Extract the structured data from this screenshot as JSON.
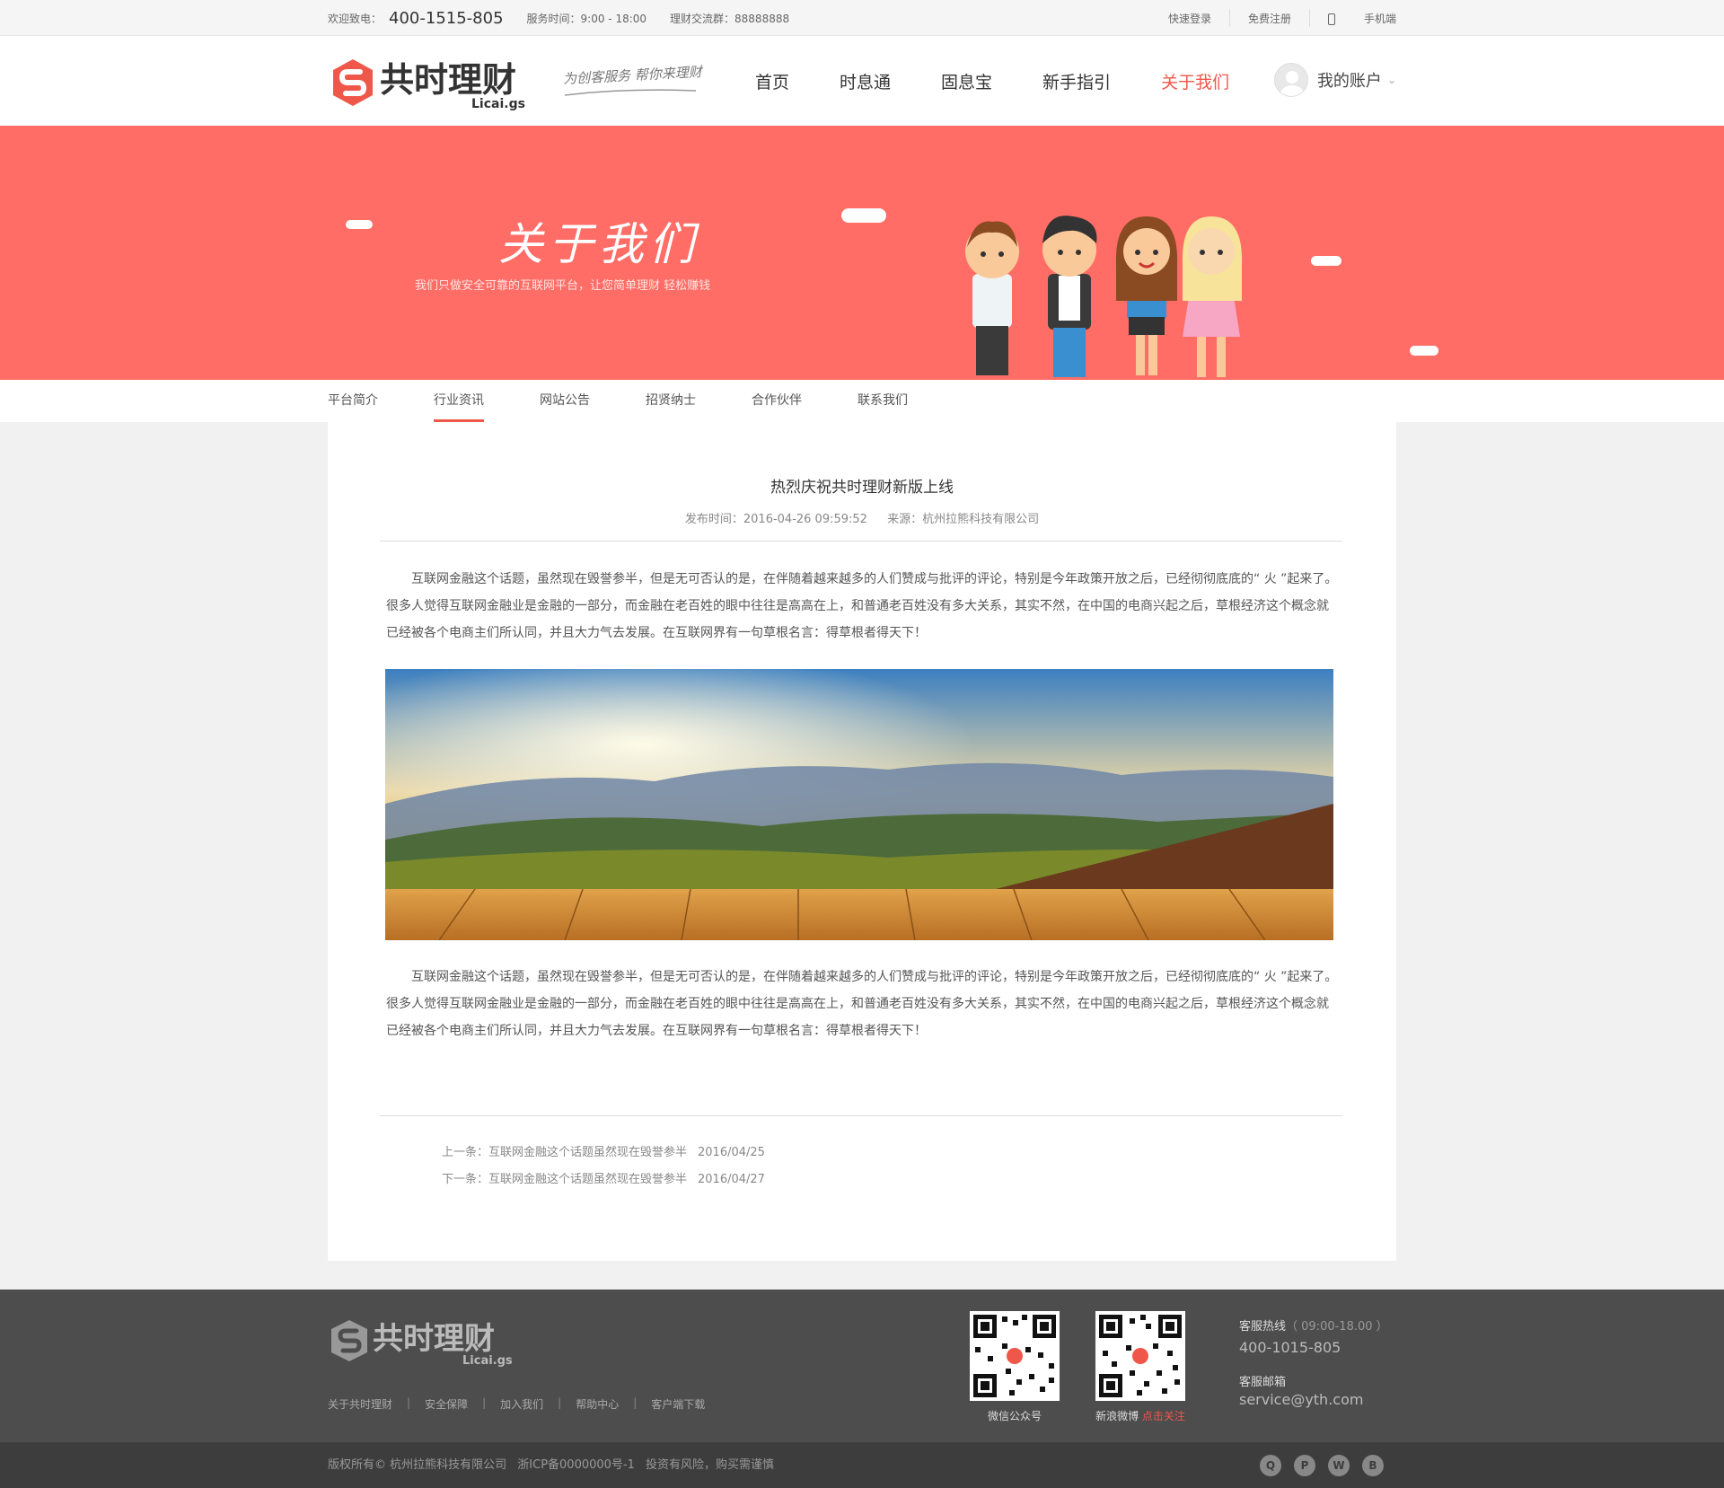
{
  "topbar": {
    "welcome": "欢迎致电：",
    "phone": "400-1515-805",
    "service_hours": "服务时间：9:00 - 18:00",
    "qq_group": "理财交流群：88888888",
    "quick_login": "快速登录",
    "register": "免费注册",
    "mobile": "手机端"
  },
  "header": {
    "slogan": "为创客服务 帮你来理财",
    "nav": [
      "首页",
      "时息通",
      "固息宝",
      "新手指引",
      "关于我们"
    ],
    "active_nav": "关于我们",
    "account": "我的账户"
  },
  "banner": {
    "title": "关于我们",
    "subtitle": "我们只做安全可靠的互联网平台，让您简单理财 轻松赚钱"
  },
  "subnav": {
    "items": [
      "平台简介",
      "行业资讯",
      "网站公告",
      "招贤纳士",
      "合作伙伴",
      "联系我们"
    ],
    "active": "行业资讯"
  },
  "article": {
    "title": "热烈庆祝共时理财新版上线",
    "publish_time": "发布时间：2016-04-26 09:59:52",
    "source": "来源：杭州拉熊科技有限公司",
    "paragraph1": "互联网金融这个话题，虽然现在毁誉参半，但是无可否认的是，在伴随着越来越多的人们赞成与批评的评论，特别是今年政策开放之后，已经彻彻底底的“ 火 ”起来了。很多人觉得互联网金融业是金融的一部分，而金融在老百姓的眼中往往是高高在上，和普通老百姓没有多大关系，其实不然，在中国的电商兴起之后，草根经济这个概念就已经被各个电商主们所认同，并且大力气去发展。在互联网界有一句草根名言：得草根者得天下！",
    "paragraph2": "互联网金融这个话题，虽然现在毁誉参半，但是无可否认的是，在伴随着越来越多的人们赞成与批评的评论，特别是今年政策开放之后，已经彻彻底底的“ 火 ”起来了。很多人觉得互联网金融业是金融的一部分，而金融在老百姓的眼中往往是高高在上，和普通老百姓没有多大关系，其实不然，在中国的电商兴起之后，草根经济这个概念就已经被各个电商主们所认同，并且大力气去发展。在互联网界有一句草根名言：得草根者得天下！",
    "prev": {
      "label": "上一条：互联网金融这个话题虽然现在毁誉参半",
      "date": "2016/04/25"
    },
    "next": {
      "label": "下一条：互联网金融这个话题虽然现在毁誉参半",
      "date": "2016/04/27"
    }
  },
  "footer": {
    "links": [
      "关于共时理财",
      "安全保障",
      "加入我们",
      "帮助中心",
      "客户端下载"
    ],
    "wechat_label": "微信公众号",
    "weibo_label": "新浪微博",
    "weibo_follow": "点击关注",
    "hotline_label": "客服热线",
    "hotline_hours": "（ 09:00-18.00 ）",
    "hotline": "400-1015-805",
    "email_label": "客服邮箱",
    "email": "service@yth.com",
    "copyright": "版权所有© 杭州拉熊科技有限公司",
    "icp": "浙ICP备0000000号-1",
    "risk": "投资有风险，购买需谨慎"
  },
  "colors": {
    "brand_red": "#f0574b",
    "banner_bg": "#ff6d66",
    "footer_bg": "#4d4d4d"
  }
}
